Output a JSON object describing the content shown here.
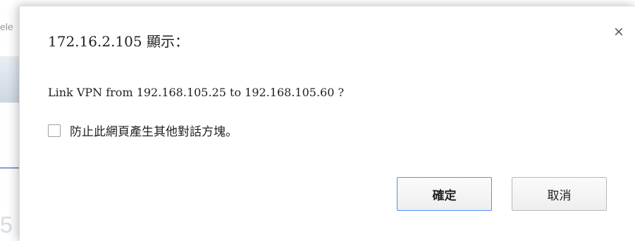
{
  "background": {
    "partial_text": "ele"
  },
  "dialog": {
    "title": "172.16.2.105 顯示：",
    "close_icon": "×",
    "message": "Link VPN from 192.168.105.25 to 192.168.105.60 ?",
    "checkbox_label": "防止此網頁產生其他對話方塊。",
    "checkbox_checked": false,
    "ok_label": "確定",
    "cancel_label": "取消"
  },
  "colors": {
    "accent_focus_border": "#4d90fe"
  },
  "icons": {
    "close": "close-icon",
    "checkbox": "checkbox-icon"
  }
}
